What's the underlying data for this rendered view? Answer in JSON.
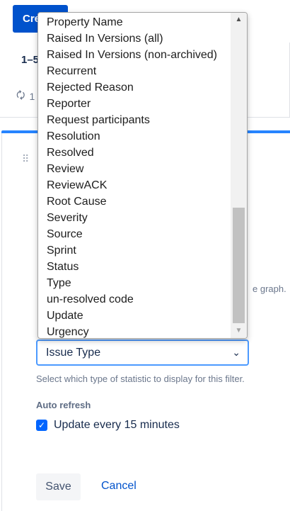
{
  "background": {
    "create_label": "Create",
    "card_title": "1–5",
    "refresh_count": "1",
    "graph_hint_fragment": "e graph."
  },
  "dropdown": {
    "options": [
      "Property Name",
      "Raised In Versions (all)",
      "Raised In Versions (non-archived)",
      "Recurrent",
      "Rejected Reason",
      "Reporter",
      "Request participants",
      "Resolution",
      "Resolved",
      "Review",
      "ReviewACK",
      "Root Cause",
      "Severity",
      "Source",
      "Sprint",
      "Status",
      "Type",
      "un-resolved code",
      "Update",
      "Urgency"
    ]
  },
  "form": {
    "statistic_type_value": "Issue Type",
    "statistic_help": "Select which type of statistic to display for this filter.",
    "auto_refresh_label": "Auto refresh",
    "auto_refresh_option": "Update every 15 minutes",
    "auto_refresh_checked": true,
    "save_label": "Save",
    "cancel_label": "Cancel"
  },
  "colors": {
    "accent": "#0052cc",
    "focus": "#4c9aff",
    "checkbox": "#0065ff"
  }
}
